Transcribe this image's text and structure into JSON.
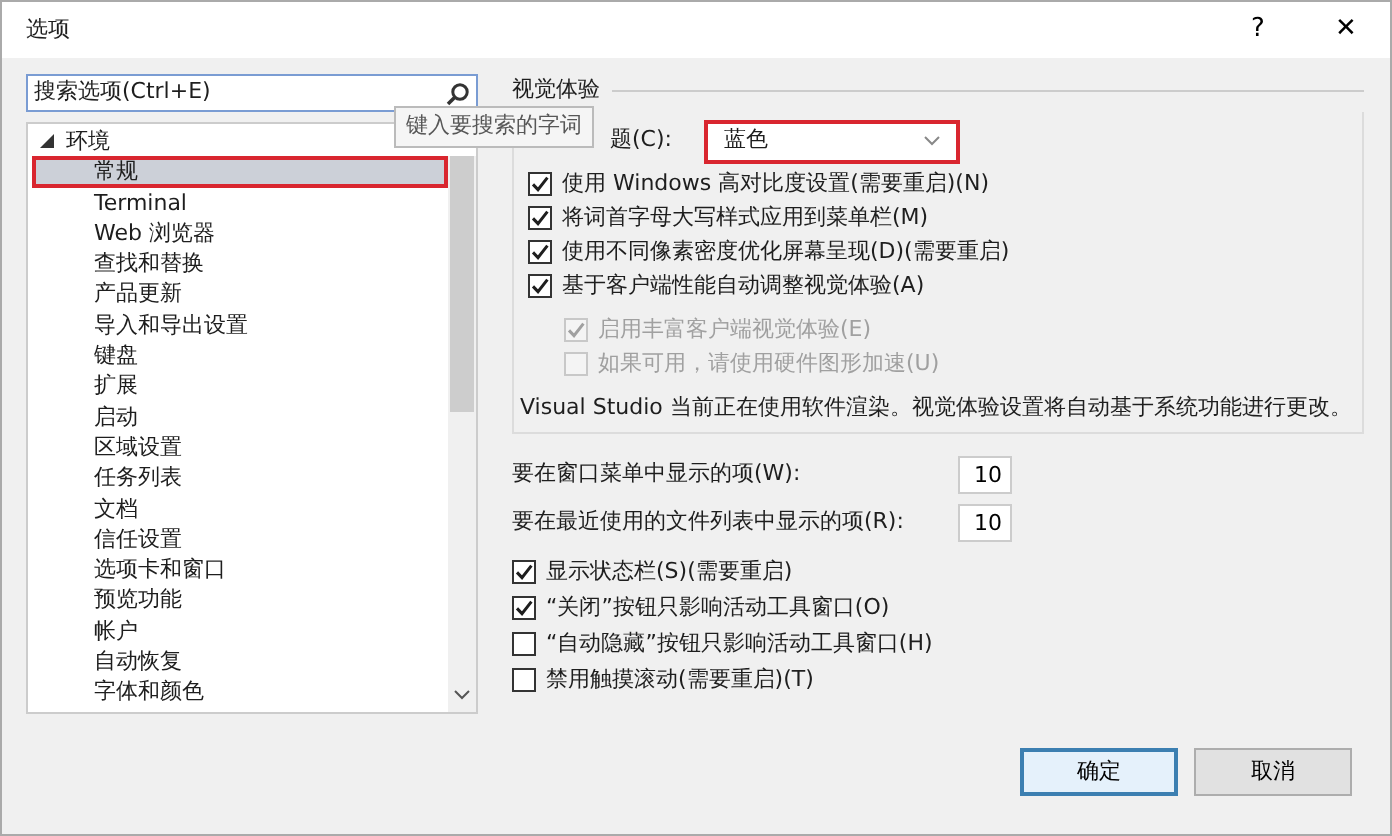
{
  "window": {
    "title": "选项",
    "help": "?",
    "close": "✕"
  },
  "search": {
    "placeholder": "搜索选项(Ctrl+E)"
  },
  "tooltip": "键入要搜索的字词",
  "tree": [
    {
      "label": "环境",
      "expanded": true,
      "children": [
        {
          "label": "常规",
          "selected": true
        },
        {
          "label": "Terminal",
          "selected": false
        },
        {
          "label": "Web 浏览器",
          "selected": false
        },
        {
          "label": "查找和替换",
          "selected": false
        },
        {
          "label": "产品更新",
          "selected": false
        },
        {
          "label": "导入和导出设置",
          "selected": false
        },
        {
          "label": "键盘",
          "selected": false
        },
        {
          "label": "扩展",
          "selected": false
        },
        {
          "label": "启动",
          "selected": false
        },
        {
          "label": "区域设置",
          "selected": false
        },
        {
          "label": "任务列表",
          "selected": false
        },
        {
          "label": "文档",
          "selected": false
        },
        {
          "label": "信任设置",
          "selected": false
        },
        {
          "label": "选项卡和窗口",
          "selected": false
        },
        {
          "label": "预览功能",
          "selected": false
        },
        {
          "label": "帐户",
          "selected": false
        },
        {
          "label": "自动恢复",
          "selected": false
        },
        {
          "label": "字体和颜色",
          "selected": false
        }
      ]
    }
  ],
  "visual": {
    "title": "视觉体验",
    "theme_label": "题(C):",
    "theme_value": "蓝色",
    "options": [
      {
        "label": "使用 Windows 高对比度设置(需要重启)(N)",
        "checked": true,
        "disabled": false,
        "nested": false
      },
      {
        "label": "将词首字母大写样式应用到菜单栏(M)",
        "checked": true,
        "disabled": false,
        "nested": false
      },
      {
        "label": "使用不同像素密度优化屏幕呈现(D)(需要重启)",
        "checked": true,
        "disabled": false,
        "nested": false
      },
      {
        "label": "基于客户端性能自动调整视觉体验(A)",
        "checked": true,
        "disabled": false,
        "nested": false
      },
      {
        "label": "启用丰富客户端视觉体验(E)",
        "checked": true,
        "disabled": true,
        "nested": true
      },
      {
        "label": "如果可用，请使用硬件图形加速(U)",
        "checked": false,
        "disabled": true,
        "nested": true
      }
    ],
    "note": "Visual Studio 当前正在使用软件渲染。视觉体验设置将自动基于系统功能进行更改。"
  },
  "counts": [
    {
      "label": "要在窗口菜单中显示的项(W):",
      "value": "10"
    },
    {
      "label": "要在最近使用的文件列表中显示的项(R):",
      "value": "10"
    }
  ],
  "options": [
    {
      "label": "显示状态栏(S)(需要重启)",
      "checked": true
    },
    {
      "label": "“关闭”按钮只影响活动工具窗口(O)",
      "checked": true
    },
    {
      "label": "“自动隐藏”按钮只影响活动工具窗口(H)",
      "checked": false
    },
    {
      "label": "禁用触摸滚动(需要重启)(T)",
      "checked": false
    }
  ],
  "buttons": [
    {
      "label": "确定",
      "default": true
    },
    {
      "label": "取消",
      "default": false
    }
  ]
}
